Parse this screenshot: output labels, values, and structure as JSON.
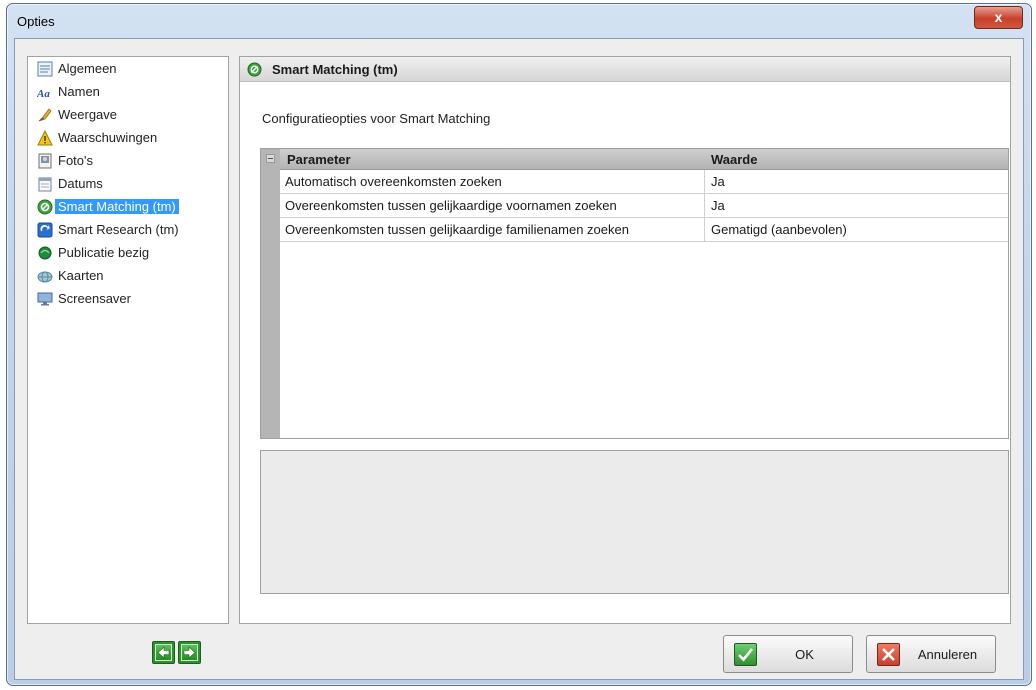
{
  "window": {
    "title": "Opties",
    "close_label": "x"
  },
  "sidebar": {
    "items": [
      {
        "label": "Algemeen",
        "icon": "general-settings-icon"
      },
      {
        "label": "Namen",
        "icon": "names-icon"
      },
      {
        "label": "Weergave",
        "icon": "display-brush-icon"
      },
      {
        "label": "Waarschuwingen",
        "icon": "warning-icon"
      },
      {
        "label": "Foto's",
        "icon": "photo-icon"
      },
      {
        "label": "Datums",
        "icon": "calendar-icon"
      },
      {
        "label": "Smart Matching (tm)",
        "icon": "smart-matching-icon",
        "selected": true
      },
      {
        "label": "Smart Research (tm)",
        "icon": "smart-research-icon"
      },
      {
        "label": "Publicatie bezig",
        "icon": "publish-icon"
      },
      {
        "label": "Kaarten",
        "icon": "globe-map-icon"
      },
      {
        "label": "Screensaver",
        "icon": "monitor-icon"
      }
    ]
  },
  "panel": {
    "title": "Smart Matching (tm)",
    "description": "Configuratieopties voor Smart Matching",
    "grid": {
      "headers": {
        "parameter": "Parameter",
        "value": "Waarde"
      },
      "rows": [
        {
          "parameter": "Automatisch overeenkomsten zoeken",
          "value": "Ja"
        },
        {
          "parameter": "Overeenkomsten tussen gelijkaardige voornamen zoeken",
          "value": "Ja"
        },
        {
          "parameter": "Overeenkomsten tussen gelijkaardige familienamen zoeken",
          "value": "Gematigd (aanbevolen)"
        }
      ]
    }
  },
  "footer": {
    "ok_label": "OK",
    "cancel_label": "Annuleren"
  },
  "colors": {
    "selection": "#3399ff",
    "ok_green": "#3fa33f",
    "cancel_red": "#d9402b"
  }
}
